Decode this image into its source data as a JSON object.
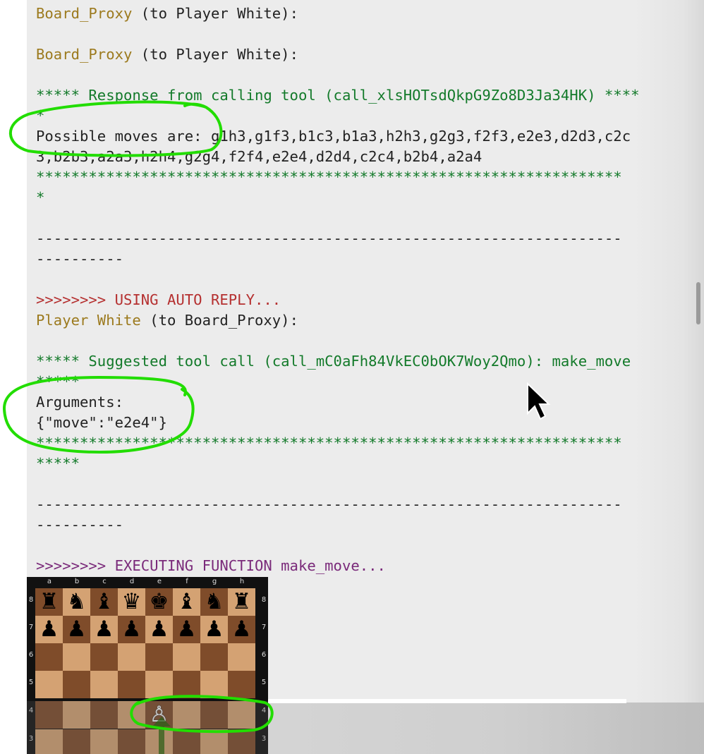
{
  "top_clip": "_s___s__",
  "log": [
    {
      "speaker": "Board_Proxy",
      "rest": " (to Player White):"
    },
    {
      "speaker": "Board_Proxy",
      "rest": " (to Player White):"
    }
  ],
  "tool_response": {
    "header": "***** Response from calling tool (call_xlsHOTsdQkpG9Zo8D3Ja34HK) ****",
    "header_wrap": "*",
    "moves_line1": "Possible moves are: g1h3,g1f3,b1c3,b1a3,h2h3,g2g3,f2f3,e2e3,d2d3,c2c",
    "moves_line2": "3,b2b3,a2a3,h2h4,g2g4,f2f4,e2e4,d2d4,c2c4,b2b4,a2a4",
    "footer": "*******************************************************************",
    "footer_wrap": "*"
  },
  "separator1": "-------------------------------------------------------------------",
  "separator1_wrap": "----------",
  "auto_reply": ">>>>>>>> USING AUTO REPLY...",
  "player_line": {
    "speaker": "Player White",
    "rest": " (to Board_Proxy):"
  },
  "suggested": {
    "header": "***** Suggested tool call (call_mC0aFh84VkEC0bOK7Woy2Qmo): make_move",
    "header_wrap": "*****",
    "args_label": "Arguments:",
    "args_value": "{\"move\":\"e2e4\"}",
    "footer": "*******************************************************************",
    "footer_wrap": "*****"
  },
  "separator2": "-------------------------------------------------------------------",
  "separator2_wrap": "----------",
  "executing": ">>>>>>>> EXECUTING FUNCTION make_move...",
  "board": {
    "files": [
      "a",
      "b",
      "c",
      "d",
      "e",
      "f",
      "g",
      "h"
    ],
    "ranks": [
      "8",
      "7",
      "6",
      "5",
      "4",
      "3"
    ],
    "rank8": [
      "♜",
      "♞",
      "♝",
      "♛",
      "♚",
      "♝",
      "♞",
      "♜"
    ],
    "rank7": [
      "♟",
      "♟",
      "♟",
      "♟",
      "♟",
      "♟",
      "♟",
      "♟"
    ],
    "rank4_e": "♙",
    "last_move": "e2e4"
  },
  "colors": {
    "annotation": "#22dd00",
    "light_square": "#d4a273",
    "dark_square": "#7f4c2a",
    "move_arrow": "#2f5f1a"
  }
}
